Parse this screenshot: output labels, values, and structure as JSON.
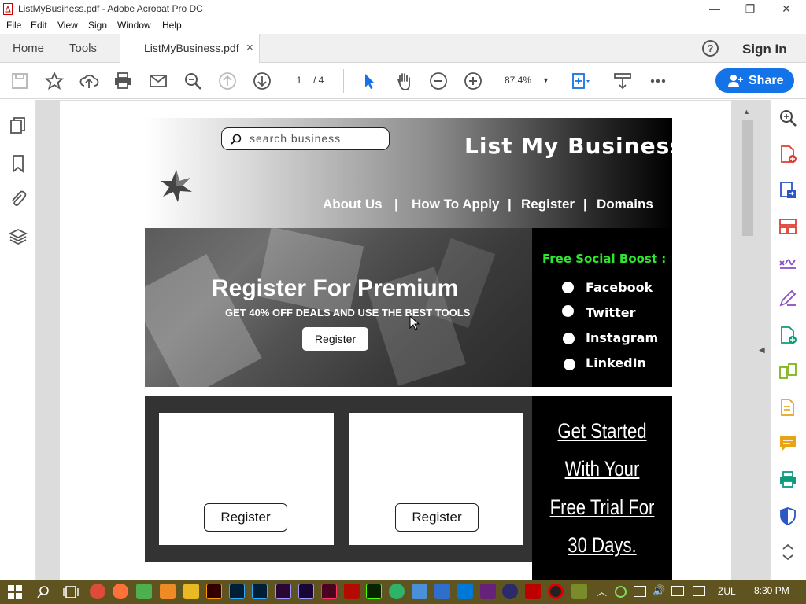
{
  "window": {
    "title": "ListMyBusiness.pdf - Adobe Acrobat Pro DC",
    "controls": [
      "minimize",
      "restore",
      "close"
    ]
  },
  "menu": [
    "File",
    "Edit",
    "View",
    "Sign",
    "Window",
    "Help"
  ],
  "tabs": {
    "home": "Home",
    "tools": "Tools",
    "document": "ListMyBusiness.pdf",
    "close": "×",
    "help": "?",
    "sign_in": "Sign In"
  },
  "toolbar": {
    "page_current": "1",
    "page_total": "/  4",
    "zoom": "87.4%",
    "share": "Share"
  },
  "page": {
    "search_placeholder": "search business",
    "site_title": "List My Business",
    "nav": [
      "About Us",
      "How To Apply",
      "Register",
      "Domains"
    ],
    "nav_sep": "|",
    "hero_title": "Register For Premium",
    "hero_subtitle": "GET 40% OFF DEALS AND USE THE BEST TOOLS",
    "hero_button": "Register",
    "social_title": "Free Social Boost :",
    "social_items": [
      "Facebook",
      "Twitter",
      "Instagram",
      "LinkedIn"
    ],
    "card_buttons": [
      "Register",
      "Register"
    ],
    "trial_lines": [
      "Get Started",
      "With Your",
      "Free Trial For",
      "30 Days."
    ]
  },
  "taskbar": {
    "language": "ZUL",
    "time": "8:30 PM"
  },
  "colors": {
    "accent": "#1473e6",
    "social_title": "#2ee62e",
    "taskbar": "#5f5320"
  }
}
